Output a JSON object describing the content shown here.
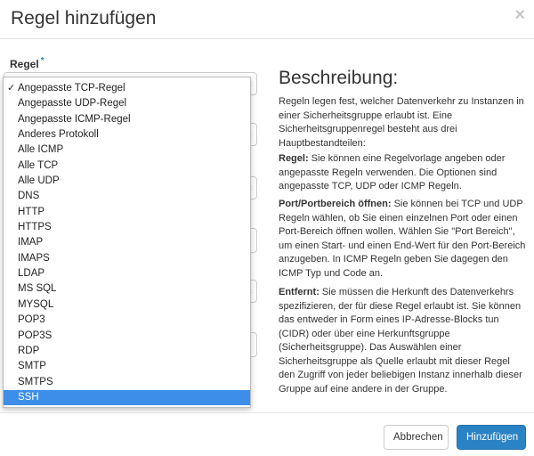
{
  "modal": {
    "title": "Regel hinzufügen",
    "close_label": "×"
  },
  "form": {
    "rule_label": "Regel",
    "required_marker": "*",
    "rule_options": [
      "Angepasste TCP-Regel",
      "Angepasste UDP-Regel",
      "Angepasste ICMP-Regel",
      "Anderes Protokoll",
      "Alle ICMP",
      "Alle TCP",
      "Alle UDP",
      "DNS",
      "HTTP",
      "HTTPS",
      "IMAP",
      "IMAPS",
      "LDAP",
      "MS SQL",
      "MYSQL",
      "POP3",
      "POP3S",
      "RDP",
      "SMTP",
      "SMTPS",
      "SSH"
    ],
    "checked_option": "Angepasste TCP-Regel",
    "highlighted_option": "SSH"
  },
  "description": {
    "title": "Beschreibung:",
    "intro": "Regeln legen fest, welcher Datenverkehr zu Instanzen in einer Sicherheitsgruppe erlaubt ist. Eine Sicherheitsgruppenregel besteht aus drei Hauptbestandteilen:",
    "rule_term": "Regel:",
    "rule_text": " Sie können eine Regelvorlage angeben oder angepasste Regeln verwenden. Die Optionen sind angepasste TCP, UDP oder ICMP Regeln.",
    "port_term": "Port/Portbereich öffnen:",
    "port_text": " Sie können bei TCP und UDP Regeln wählen, ob Sie einen einzelnen Port oder einen Port-Bereich öffnen wollen. Wählen Sie \"Port Bereich\", um einen Start- und einen End-Wert für den Port-Bereich anzugeben. In ICMP Regeln geben Sie dagegen den ICMP Typ und Code an.",
    "remote_term": "Entfernt:",
    "remote_text": " Sie müssen die Herkunft des Datenverkehrs spezifizieren, der für diese Regel erlaubt ist. Sie können das entweder in Form eines IP-Adresse-Blocks tun (CIDR) oder über eine Herkunftsgruppe (Sicherheitsgruppe). Das Auswählen einer Sicherheitsgruppe als Quelle erlaubt mit dieser Regel den Zugriff von jeder beliebigen Instanz innerhalb dieser Gruppe auf eine andere in der Gruppe."
  },
  "footer": {
    "cancel_label": "Abbrechen",
    "submit_label": "Hinzufügen"
  },
  "colors": {
    "primary": "#2a83c4",
    "highlight": "#3d8ee8",
    "required": "#2a83c4"
  }
}
